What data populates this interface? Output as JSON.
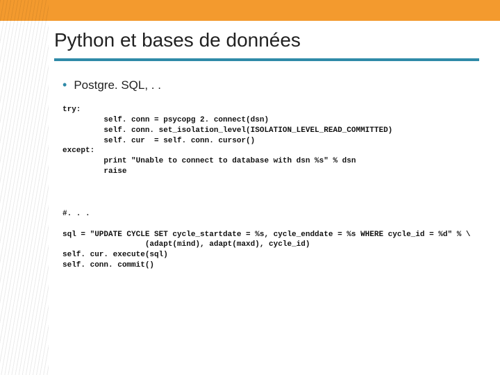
{
  "slide": {
    "title": "Python et bases de données",
    "bullet": "Postgre. SQL, . .",
    "code_top": "try:\n         self. conn = psycopg 2. connect(dsn)\n         self. conn. set_isolation_level(ISOLATION_LEVEL_READ_COMMITTED)\n         self. cur  = self. conn. cursor()\nexcept:\n         print \"Unable to connect to database with dsn %s\" % dsn\n         raise",
    "code_bottom": "#. . .\n\nsql = \"UPDATE CYCLE SET cycle_startdate = %s, cycle_enddate = %s WHERE cycle_id = %d\" % \\\n                  (adapt(mind), adapt(maxd), cycle_id)\nself. cur. execute(sql)\nself. conn. commit()"
  }
}
